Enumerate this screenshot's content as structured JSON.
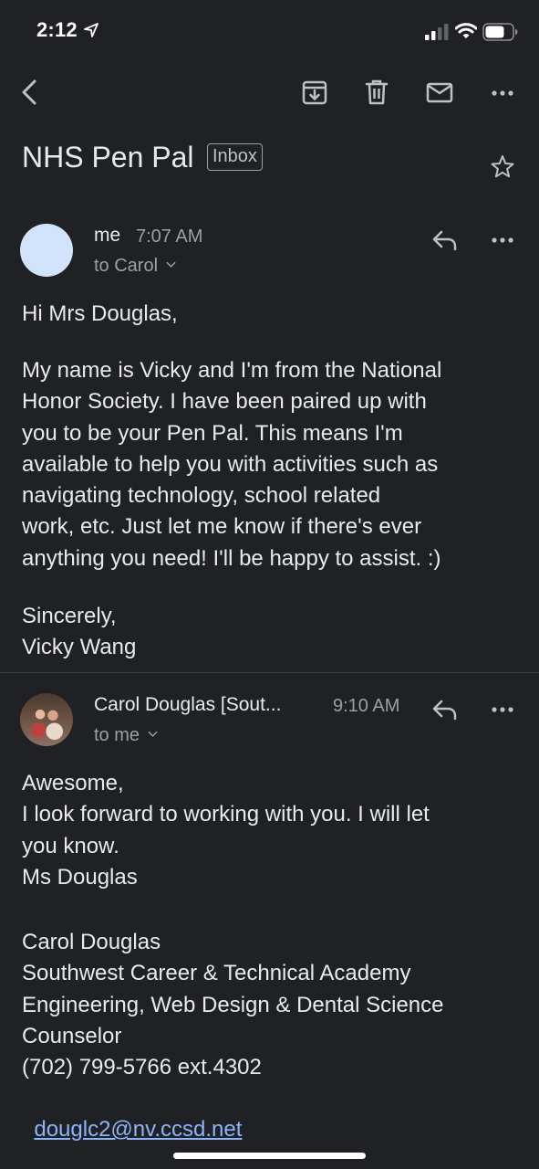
{
  "status_bar": {
    "time": "2:12"
  },
  "email": {
    "subject": "NHS Pen Pal",
    "label": "Inbox"
  },
  "messages": [
    {
      "sender": "me",
      "time": "7:07 AM",
      "to": "to Carol",
      "avatar_color": "#d2e3fc",
      "body": [
        "Hi Mrs Douglas,",
        "My name is Vicky and I'm from the National\nHonor Society. I have been paired up with\nyou to be your Pen Pal. This means I'm\navailable to help you with activities such as\nnavigating technology, school related\nwork, etc. Just let me know if there's ever\nanything you need! I'll be happy to assist. :)",
        "Sincerely,\nVicky Wang"
      ]
    },
    {
      "sender": "Carol Douglas [Sout...",
      "time": "9:10 AM",
      "to": "to me",
      "body": [
        "Awesome,\nI look forward to working with you. I will let\nyou know.\nMs Douglas",
        "Carol Douglas\nSouthwest Career & Technical Academy\nEngineering, Web Design & Dental Science\nCounselor\n(702) 799-5766 ext.4302"
      ],
      "email_link": "douglc2@nv.ccsd.net"
    }
  ],
  "colors": {
    "background": "#202124",
    "text": "#e8eaed",
    "secondary": "#9aa0a6",
    "link": "#8ab4f8"
  }
}
